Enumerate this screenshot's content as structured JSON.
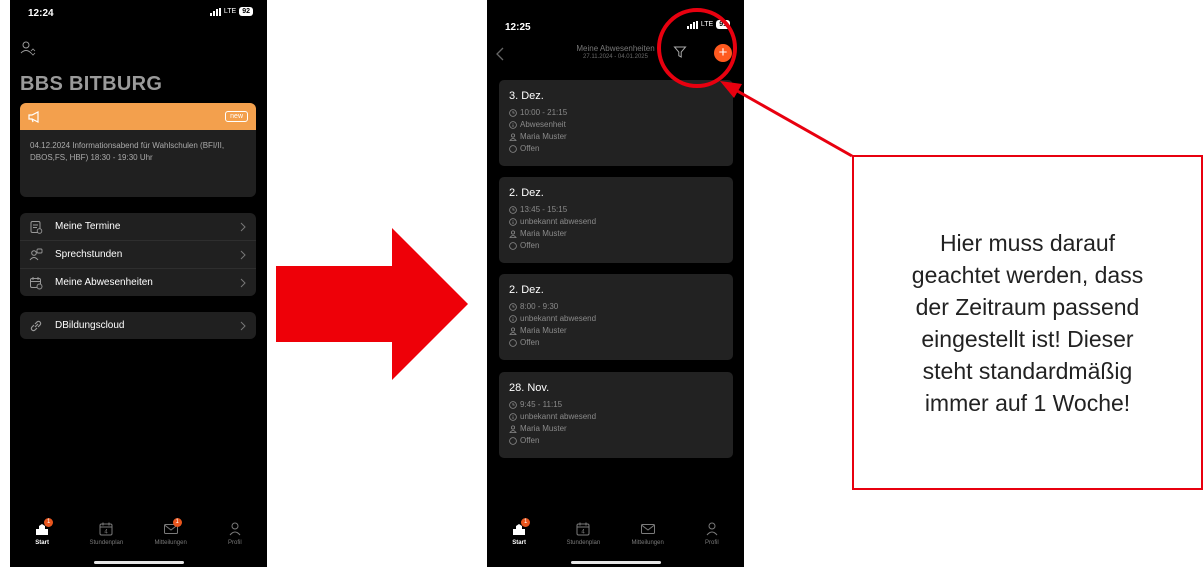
{
  "colors": {
    "accent_orange": "#f3a04d",
    "badge_red": "#e8551d",
    "annotation_red": "#e8000f",
    "add_button": "#ff5a1f"
  },
  "screen1": {
    "status": {
      "time": "12:24",
      "network": "LTE",
      "battery": "92"
    },
    "school_title": "BBS BITBURG",
    "news": {
      "icon": "megaphone-icon",
      "badge": "new",
      "text": "04.12.2024 Informationsabend für Wahlschulen (BFI/II, DBOS,FS, HBF) 18:30 - 19:30 Uhr"
    },
    "menu": [
      {
        "label": "Meine Termine",
        "icon": "appointments-icon"
      },
      {
        "label": "Sprechstunden",
        "icon": "consultation-icon"
      },
      {
        "label": "Meine Abwesenheiten",
        "icon": "calendar-clock-icon"
      }
    ],
    "link": {
      "label": "DBildungscloud",
      "icon": "link-icon"
    },
    "tabs": [
      {
        "label": "Start",
        "badge": "1"
      },
      {
        "label": "Stundenplan",
        "day": "4"
      },
      {
        "label": "Mitteilungen",
        "badge": "1"
      },
      {
        "label": "Profil"
      }
    ]
  },
  "screen2": {
    "status": {
      "time": "12:25",
      "network": "LTE",
      "battery": "91"
    },
    "nav": {
      "title": "Meine Abwesenheiten",
      "subtitle": "27.11.2024 - 04.01.2025",
      "add": "+"
    },
    "absences": [
      {
        "date": "3. Dez.",
        "time": "10:00 - 21:15",
        "type": "Abwesenheit",
        "person": "Maria Muster",
        "status": "Offen"
      },
      {
        "date": "2. Dez.",
        "time": "13:45 - 15:15",
        "type": "unbekannt abwesend",
        "person": "Maria Muster",
        "status": "Offen"
      },
      {
        "date": "2. Dez.",
        "time": "8:00 - 9:30",
        "type": "unbekannt abwesend",
        "person": "Maria Muster",
        "status": "Offen"
      },
      {
        "date": "28. Nov.",
        "time": "9:45 - 11:15",
        "type": "unbekannt abwesend",
        "person": "Maria Muster",
        "status": "Offen"
      }
    ],
    "tabs": [
      {
        "label": "Start",
        "badge": "1"
      },
      {
        "label": "Stundenplan",
        "day": "4"
      },
      {
        "label": "Mitteilungen"
      },
      {
        "label": "Profil"
      }
    ]
  },
  "annotation": {
    "callout_text": "Hier muss darauf geachtet werden, dass der Zeitraum passend eingestellt ist! Dieser steht standardmäßig immer auf 1 Woche!"
  }
}
